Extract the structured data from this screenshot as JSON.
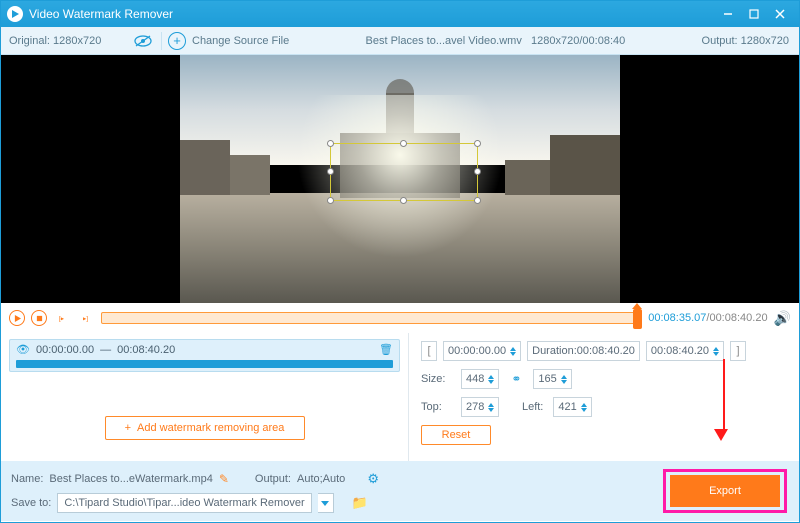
{
  "titlebar": {
    "title": "Video Watermark Remover"
  },
  "toolbar": {
    "original": "Original: 1280x720",
    "change_label": "Change Source File",
    "filename": "Best Places to...avel Video.wmv",
    "filemeta": "1280x720/00:08:40",
    "output": "Output: 1280x720"
  },
  "playbar": {
    "current": "00:08:35.07",
    "total": "/00:08:40.20"
  },
  "segment": {
    "start": "00:00:00.00",
    "sep": "—",
    "end": "00:08:40.20"
  },
  "add_area": "Add watermark removing area",
  "params": {
    "start": "00:00:00.00",
    "duration_label": "Duration:",
    "duration": "00:08:40.20",
    "end": "00:08:40.20",
    "size_label": "Size:",
    "width": "448",
    "height": "165",
    "top_label": "Top:",
    "top": "278",
    "left_label": "Left:",
    "left": "421",
    "reset": "Reset"
  },
  "bottom": {
    "name_label": "Name:",
    "name": "Best Places to...eWatermark.mp4",
    "output_label": "Output:",
    "output": "Auto;Auto",
    "save_label": "Save to:",
    "save_path": "C:\\Tipard Studio\\Tipar...ideo Watermark Remover",
    "export": "Export"
  }
}
